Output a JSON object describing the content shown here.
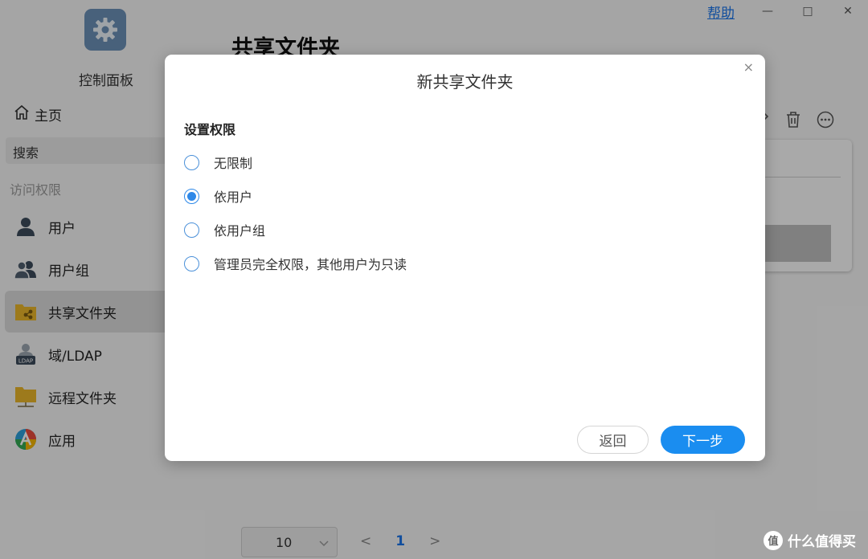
{
  "window": {
    "help_label": "帮助",
    "minimize_glyph": "—",
    "maximize_glyph": "□",
    "close_glyph": "✕"
  },
  "sidebar": {
    "app_name": "控制面板",
    "home_label": "主页",
    "search_label": "搜索",
    "section_label": "访问权限",
    "items": [
      {
        "label": "用户",
        "icon": "user-icon"
      },
      {
        "label": "用户组",
        "icon": "user-group-icon"
      },
      {
        "label": "共享文件夹",
        "icon": "shared-folder-icon",
        "active": true
      },
      {
        "label": "域/LDAP",
        "icon": "ldap-icon"
      },
      {
        "label": "远程文件夹",
        "icon": "remote-folder-icon"
      },
      {
        "label": "应用",
        "icon": "app-icon"
      }
    ]
  },
  "main": {
    "page_title": "共享文件夹"
  },
  "footer": {
    "page_size": "10",
    "current_page": "1",
    "prev_glyph": "<",
    "next_glyph": ">"
  },
  "watermark": {
    "circle_text": "值",
    "text": "什么值得买"
  },
  "dialog": {
    "title": "新共享文件夹",
    "close_glyph": "×",
    "section_title": "设置权限",
    "options": [
      {
        "label": "无限制",
        "checked": false
      },
      {
        "label": "依用户",
        "checked": true
      },
      {
        "label": "依用户组",
        "checked": false
      },
      {
        "label": "管理员完全权限，其他用户为只读",
        "checked": false
      }
    ],
    "back_label": "返回",
    "next_label": "下一步"
  },
  "colors": {
    "accent": "#1a8df0",
    "link": "#1a73e8"
  }
}
